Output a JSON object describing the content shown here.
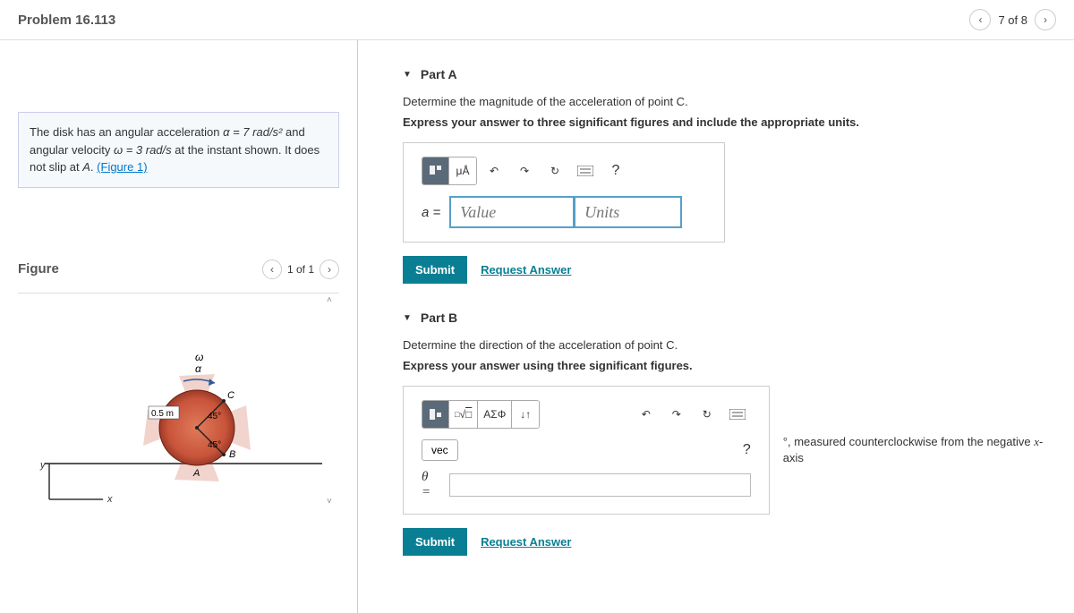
{
  "header": {
    "title": "Problem 16.113",
    "position": "7 of 8"
  },
  "problem": {
    "text_start": "The disk has an angular acceleration ",
    "alpha": "α = 7  rad/s²",
    "text_mid1": " and angular velocity ",
    "omega": "ω = 3  rad/s",
    "text_mid2": " at the instant shown. It does not slip at ",
    "pointA": "A",
    "text_end": ". ",
    "figure_link": "(Figure 1)"
  },
  "figure": {
    "title": "Figure",
    "position": "1 of 1",
    "labels": {
      "omega": "ω",
      "alpha": "α",
      "C": "C",
      "B": "B",
      "A": "A",
      "radius": "0.5 m",
      "angle1": "45°",
      "angle2": "45°",
      "x": "x",
      "y": "y"
    }
  },
  "partA": {
    "title": "Part A",
    "prompt": "Determine the magnitude of the acceleration of point C.",
    "instruction": "Express your answer to three significant figures and include the appropriate units.",
    "toolbar": {
      "units": "μÅ",
      "help": "?"
    },
    "var": "a =",
    "value_placeholder": "Value",
    "units_placeholder": "Units",
    "submit": "Submit",
    "request": "Request Answer"
  },
  "partB": {
    "title": "Part B",
    "prompt": "Determine the direction of the acceleration of point C.",
    "instruction": "Express your answer using three significant figures.",
    "toolbar": {
      "sqrt": "√",
      "greek": "ΑΣΦ",
      "arrows": "↓↑",
      "vec": "vec",
      "help": "?"
    },
    "var": "θ =",
    "post_text": "°, measured counterclockwise from the negative x-axis",
    "submit": "Submit",
    "request": "Request Answer"
  }
}
